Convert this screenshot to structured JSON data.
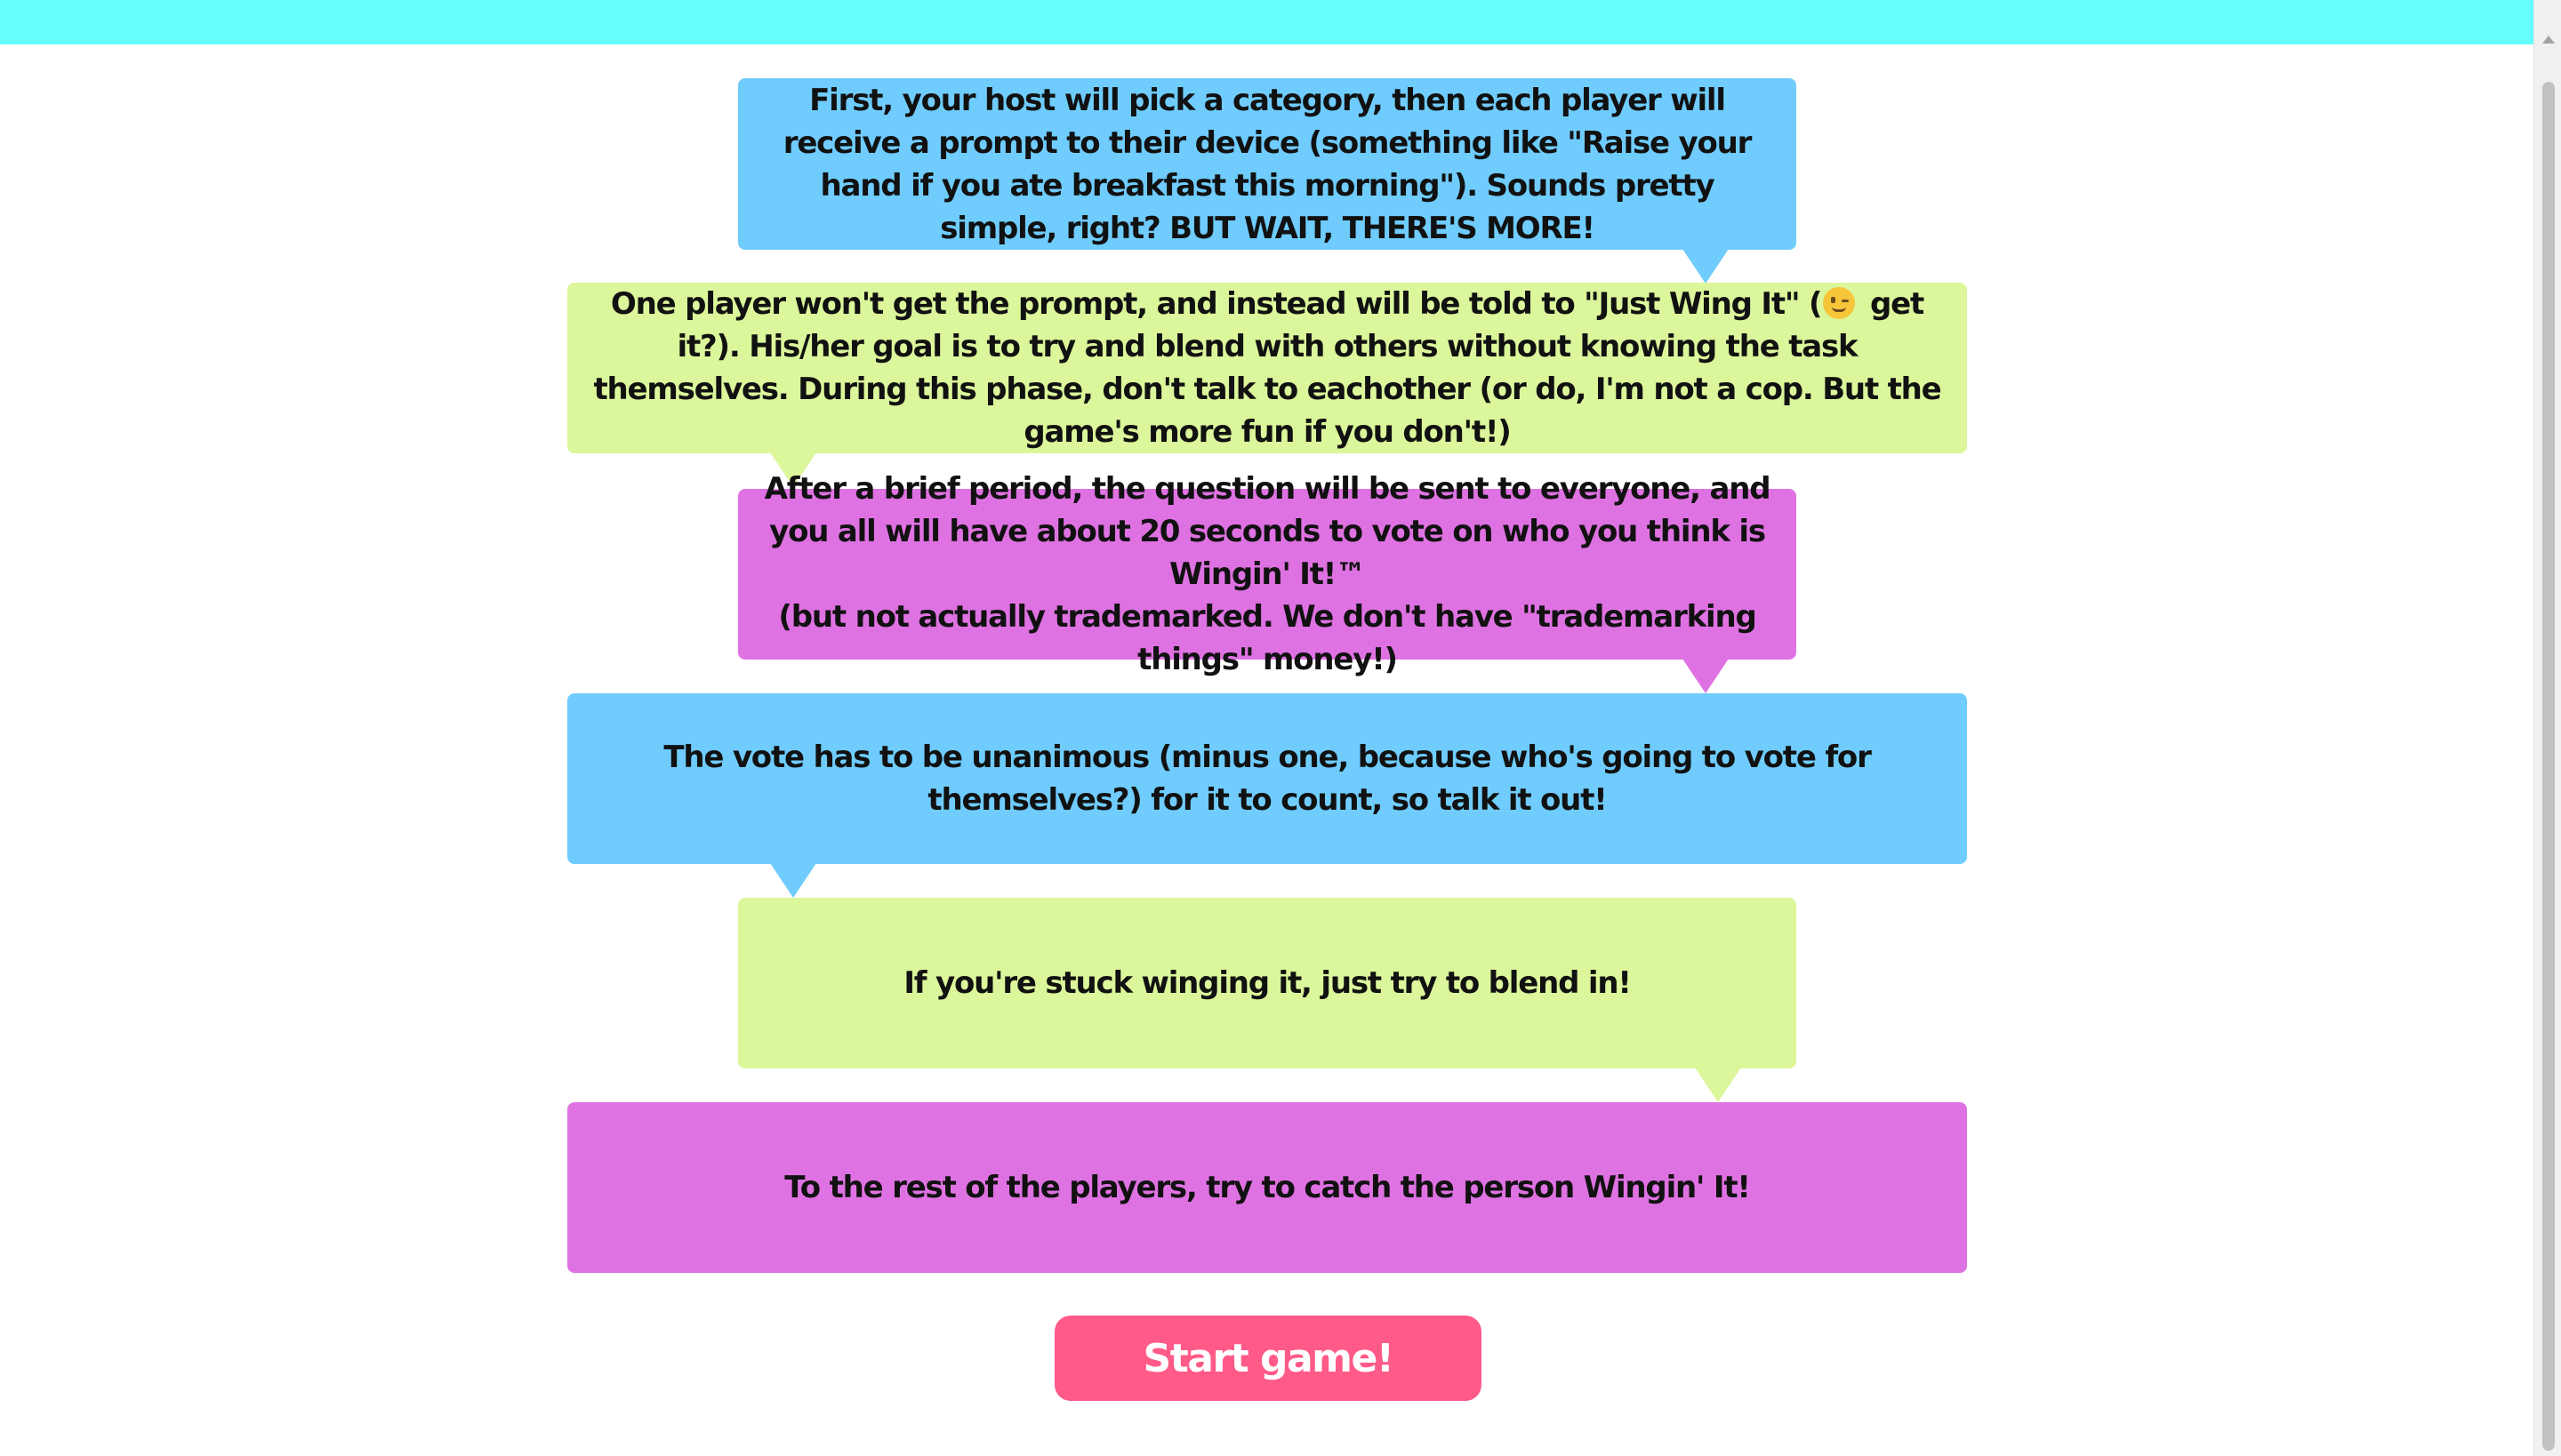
{
  "colors": {
    "top_bar": "#66fdfd",
    "blue": "#6fccfd",
    "green": "#dbf69b",
    "pink": "#df72e2",
    "button": "#ff5a88"
  },
  "steps": [
    {
      "color": "blue",
      "text": "First, your host will pick a category, then each player will receive a prompt to their device (something like \"Raise your hand if you ate breakfast this morning\"). Sounds pretty simple, right? BUT WAIT, THERE'S MORE!"
    },
    {
      "color": "green",
      "text_before_emoji": "One player won't get the prompt, and instead will be told to \"Just Wing It\" (",
      "emoji": "winking-face-icon",
      "text_after_emoji": " get it?). His/her goal is to try and blend with others without knowing the task themselves. During this phase, don't talk to eachother (or do, I'm not a cop. But the game's more fun if you don't!)"
    },
    {
      "color": "pink",
      "text": "After a brief period, the question will be sent to everyone, and you all will have about 20 seconds to vote on who you think is Wingin' It!™",
      "text_line2": "(but not actually trademarked. We don't have \"trademarking things\" money!)"
    },
    {
      "color": "blue",
      "text": "The vote has to be unanimous (minus one, because who's going to vote for themselves?) for it to count, so talk it out!"
    },
    {
      "color": "green",
      "text": "If you're stuck winging it, just try to blend in!"
    },
    {
      "color": "pink",
      "text": "To the rest of the players, try to catch the person Wingin' It!"
    }
  ],
  "start_button": {
    "label": "Start game!"
  }
}
